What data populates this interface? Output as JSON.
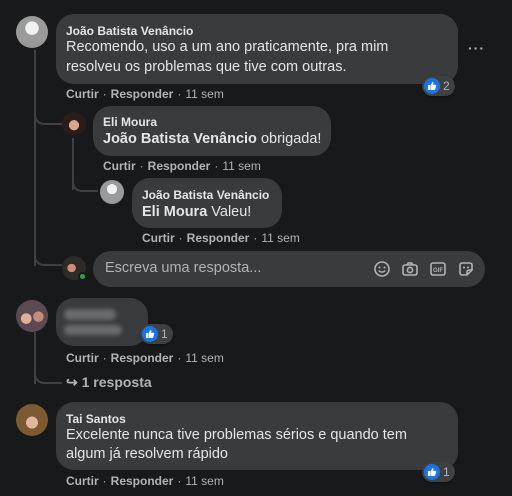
{
  "comment1": {
    "author": "João Batista Venâncio",
    "line1": "Recomendo, uso a um ano praticamente, pra mim",
    "line2": "resolveu os problemas que tive com outras.",
    "reactions": "2",
    "like": "Curtir",
    "reply": "Responder",
    "time": "11 sem",
    "more": "···"
  },
  "reply1": {
    "author": "Eli Moura",
    "mention": "João Batista Venâncio",
    "text": "obrigada!",
    "like": "Curtir",
    "reply": "Responder",
    "time": "11 sem"
  },
  "reply2": {
    "author": "João Batista Venâncio",
    "mention": "Eli Moura",
    "text": "Valeu!",
    "like": "Curtir",
    "reply": "Responder",
    "time": "11 sem"
  },
  "reply_box": {
    "placeholder": "Escreva uma resposta..."
  },
  "comment2": {
    "reactions": "1",
    "like": "Curtir",
    "reply": "Responder",
    "time": "11 sem",
    "replies_link": "1 resposta"
  },
  "comment3": {
    "author": "Tai Santos",
    "line1": "Excelente nunca tive problemas sérios e quando tem",
    "line2": "algum já resolvem rápido",
    "reactions": "1",
    "like": "Curtir",
    "reply": "Responder",
    "time": "11 sem"
  },
  "icons": {
    "reaction": "like-icon",
    "emoji": "emoji-icon",
    "camera": "camera-icon",
    "gif": "gif-icon",
    "sticker": "sticker-icon"
  },
  "colors": {
    "background": "#18191a",
    "bubble": "#3a3b3c",
    "text": "#e4e6eb",
    "secondary_text": "#b0b3b8",
    "like_blue": "#1b74e4",
    "online_green": "#31a24c"
  }
}
